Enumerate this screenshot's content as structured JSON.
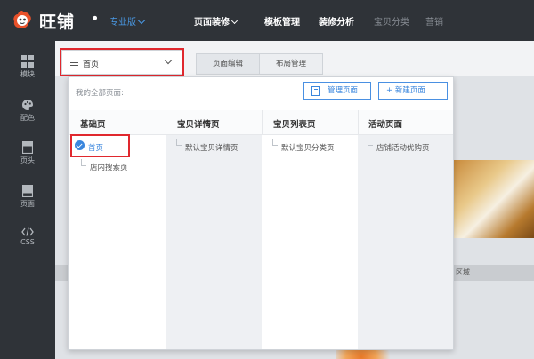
{
  "header": {
    "logo_text": "旺铺",
    "logo_dot": "•",
    "edition": "专业版",
    "nav": [
      "页面装修",
      "模板管理",
      "装修分析",
      "宝贝分类",
      "营销"
    ]
  },
  "sidebar": {
    "items": [
      {
        "label": "模块",
        "icon": "grid-icon"
      },
      {
        "label": "配色",
        "icon": "palette-icon"
      },
      {
        "label": "页头",
        "icon": "page-header-icon"
      },
      {
        "label": "页面",
        "icon": "page-icon"
      },
      {
        "label": "CSS",
        "icon": "code-icon"
      }
    ]
  },
  "toolbar": {
    "page_select_value": "首页",
    "tabs": [
      "页面编辑",
      "布局管理"
    ]
  },
  "dropdown": {
    "title": "我的全部页面:",
    "manage_button": "管理页面",
    "new_button": "+ 新建页面",
    "columns": [
      {
        "header": "基础页",
        "items": [
          "首页",
          "店内搜索页"
        ]
      },
      {
        "header": "宝贝详情页",
        "items": [
          "默认宝贝详情页"
        ]
      },
      {
        "header": "宝贝列表页",
        "items": [
          "默认宝贝分类页"
        ]
      },
      {
        "header": "活动页面",
        "items": [
          "店铺活动优购页"
        ]
      }
    ]
  },
  "canvas": {
    "strip_text": "区域"
  },
  "colors": {
    "topbar": "#2f3338",
    "accent": "#3a86dd",
    "highlight": "#e0282e"
  }
}
